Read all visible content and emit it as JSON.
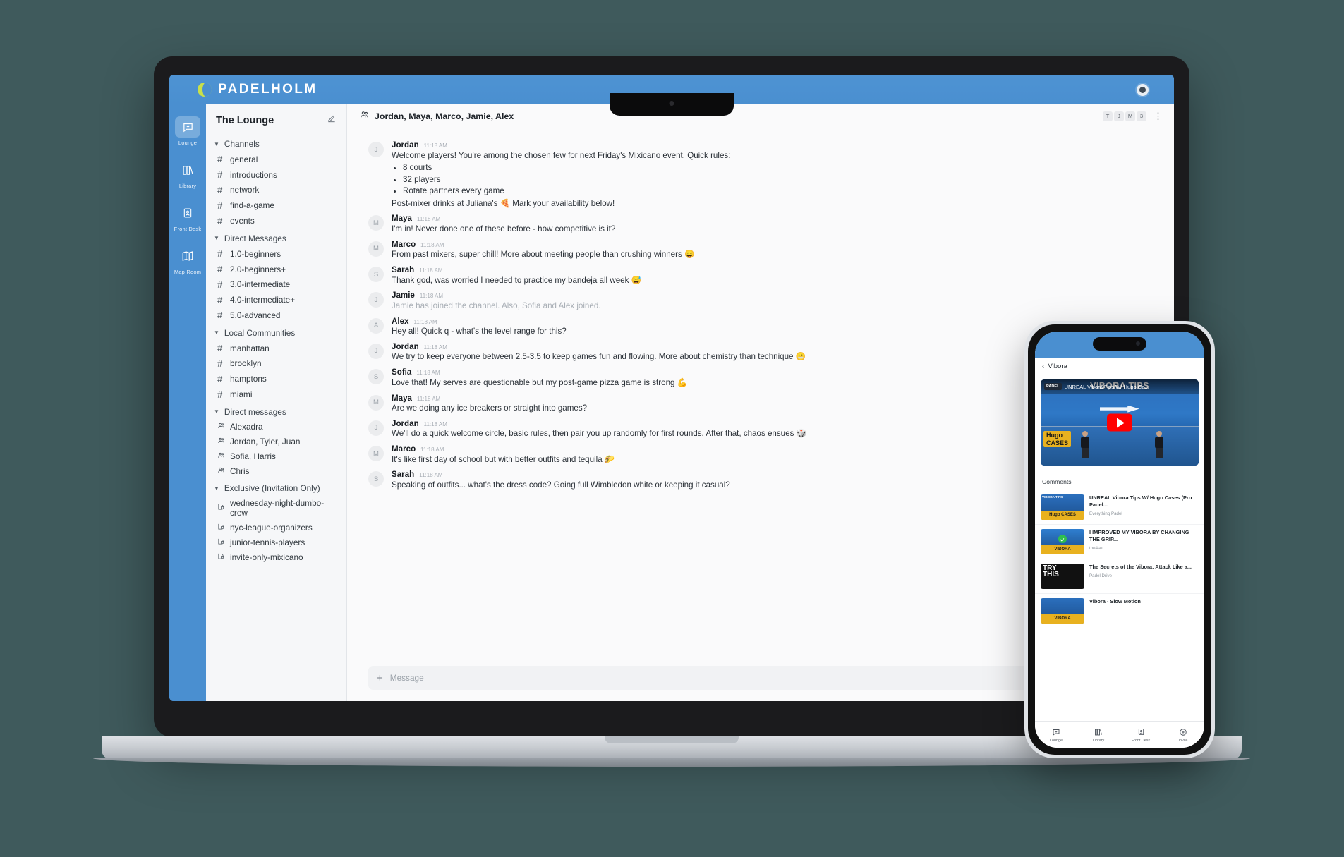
{
  "brand": {
    "name": "PADELHOLM",
    "ball_icon": "tennis-ball-icon"
  },
  "rail": {
    "items": [
      {
        "label": "Lounge",
        "icon": "chat-plus-icon",
        "active": true
      },
      {
        "label": "Library",
        "icon": "books-icon",
        "active": false
      },
      {
        "label": "Front Desk",
        "icon": "id-card-icon",
        "active": false
      },
      {
        "label": "Map Room",
        "icon": "map-icon",
        "active": false
      }
    ]
  },
  "sidebar": {
    "title": "The Lounge",
    "edit_icon": "compose-icon",
    "groups": [
      {
        "label": "Channels",
        "items": [
          {
            "label": "general",
            "icon": "hash-icon"
          },
          {
            "label": "introductions",
            "icon": "hash-icon"
          },
          {
            "label": "network",
            "icon": "hash-icon"
          },
          {
            "label": "find-a-game",
            "icon": "hash-icon"
          },
          {
            "label": "events",
            "icon": "hash-icon"
          }
        ]
      },
      {
        "label": "Direct Messages",
        "items": [
          {
            "label": "1.0-beginners",
            "icon": "hash-icon"
          },
          {
            "label": "2.0-beginners+",
            "icon": "hash-icon"
          },
          {
            "label": "3.0-intermediate",
            "icon": "hash-icon"
          },
          {
            "label": "4.0-intermediate+",
            "icon": "hash-icon"
          },
          {
            "label": "5.0-advanced",
            "icon": "hash-icon"
          }
        ]
      },
      {
        "label": "Local Communities",
        "items": [
          {
            "label": "manhattan",
            "icon": "hash-icon"
          },
          {
            "label": "brooklyn",
            "icon": "hash-icon"
          },
          {
            "label": "hamptons",
            "icon": "hash-icon"
          },
          {
            "label": "miami",
            "icon": "hash-icon"
          }
        ]
      },
      {
        "label": "Direct messages",
        "items": [
          {
            "label": "Alexadra",
            "icon": "people-icon"
          },
          {
            "label": "Jordan, Tyler, Juan",
            "icon": "people-icon"
          },
          {
            "label": "Sofia, Harris",
            "icon": "people-icon"
          },
          {
            "label": "Chris",
            "icon": "people-icon"
          }
        ]
      },
      {
        "label": "Exclusive (Invitation Only)",
        "items": [
          {
            "label": "wednesday-night-dumbo-crew",
            "icon": "locked-channel-icon"
          },
          {
            "label": "nyc-league-organizers",
            "icon": "locked-channel-icon"
          },
          {
            "label": "junior-tennis-players",
            "icon": "locked-channel-icon"
          },
          {
            "label": "invite-only-mixicano",
            "icon": "locked-channel-icon"
          }
        ]
      }
    ]
  },
  "chat": {
    "header": {
      "icon": "people-icon",
      "title": "Jordan, Maya, Marco, Jamie, Alex",
      "facepile": [
        "T",
        "J",
        "M",
        "3"
      ],
      "kebab_icon": "kebab-menu-icon"
    },
    "messages": [
      {
        "avatar": "J",
        "author": "Jordan",
        "time": "11:18 AM",
        "text": "Welcome players! You're among the chosen few for next Friday's Mixicano event. Quick rules:",
        "bullets": [
          "8 courts",
          "32 players",
          "Rotate partners every game"
        ],
        "footer": "Post-mixer drinks at Juliana's 🍕 Mark your availability below!"
      },
      {
        "avatar": "M",
        "author": "Maya",
        "time": "11:18 AM",
        "text": "I'm in! Never done one of these before - how competitive is it?"
      },
      {
        "avatar": "M",
        "author": "Marco",
        "time": "11:18 AM",
        "text": "From past mixers, super chill! More about meeting people than crushing winners 😄"
      },
      {
        "avatar": "S",
        "author": "Sarah",
        "time": "11:18 AM",
        "text": "Thank god, was worried I needed to practice my bandeja all week 😅"
      },
      {
        "avatar": "J",
        "author": "Jamie",
        "time": "11:18 AM",
        "text": "Jamie has joined the channel. Also, Sofia and Alex joined.",
        "muted": true
      },
      {
        "avatar": "A",
        "author": "Alex",
        "time": "11:18 AM",
        "text": "Hey all! Quick q - what's the level range for this?"
      },
      {
        "avatar": "J",
        "author": "Jordan",
        "time": "11:18 AM",
        "text": "We try to keep everyone between 2.5-3.5 to keep games fun and flowing. More about chemistry than technique 😬"
      },
      {
        "avatar": "S",
        "author": "Sofia",
        "time": "11:18 AM",
        "text": "Love that! My serves are questionable but my post-game pizza game is strong 💪"
      },
      {
        "avatar": "M",
        "author": "Maya",
        "time": "11:18 AM",
        "text": "Are we doing any ice breakers or straight into games?"
      },
      {
        "avatar": "J",
        "author": "Jordan",
        "time": "11:18 AM",
        "text": "We'll do a quick welcome circle, basic rules, then pair you up randomly for first rounds. After that, chaos ensues 🎲"
      },
      {
        "avatar": "M",
        "author": "Marco",
        "time": "11:18 AM",
        "text": "It's like first day of school but with better outfits and tequila 🌮"
      },
      {
        "avatar": "S",
        "author": "Sarah",
        "time": "11:18 AM",
        "text": "Speaking of outfits... what's the dress code? Going full Wimbledon white or keeping it casual?"
      }
    ],
    "composer": {
      "plus_icon": "plus-icon",
      "placeholder": "Message",
      "value": ""
    }
  },
  "phone": {
    "nav": {
      "back_icon": "chevron-left-icon",
      "title": "Vibora"
    },
    "video": {
      "overlay_title": "VIBORA TIPS",
      "player_title": "UNREAL Vibora Tips W/ Hugo Ca...",
      "channel_chip": "PADEL",
      "badge_line1": "Hugo",
      "badge_line2": "CASES",
      "play_icon": "youtube-play-icon",
      "kebab_icon": "kebab-menu-icon"
    },
    "comments_label": "Comments",
    "related": [
      {
        "title": "UNREAL Vibora Tips W/ Hugo Cases (Pro Padel...",
        "channel": "Everything Padel",
        "thumb_label": "VIBORA TIPS",
        "thumb_band": "Hugo CASES",
        "thumb_style": "yellow"
      },
      {
        "title": "I IMPROVED MY VIBORA BY CHANGING THE GRIP...",
        "channel": "the4set",
        "thumb_label": "",
        "thumb_band": "VIBORA",
        "thumb_style": "green"
      },
      {
        "title": "The Secrets of the Vibora: Attack Like a...",
        "channel": "Padel Drive",
        "thumb_label": "TRY THIS",
        "thumb_band": "",
        "thumb_style": "red"
      },
      {
        "title": "Vibora - Slow Motion",
        "channel": "",
        "thumb_label": "",
        "thumb_band": "VIBORA",
        "thumb_style": "yellow"
      }
    ],
    "tabs": [
      {
        "label": "Lounge",
        "icon": "chat-plus-icon"
      },
      {
        "label": "Library",
        "icon": "books-icon"
      },
      {
        "label": "Front Desk",
        "icon": "id-card-icon"
      },
      {
        "label": "Invite",
        "icon": "plus-circle-icon"
      }
    ]
  },
  "colors": {
    "brand_blue": "#4a8fd0",
    "ball_green": "#c8e04b",
    "accent_yellow": "#e8b11f"
  }
}
